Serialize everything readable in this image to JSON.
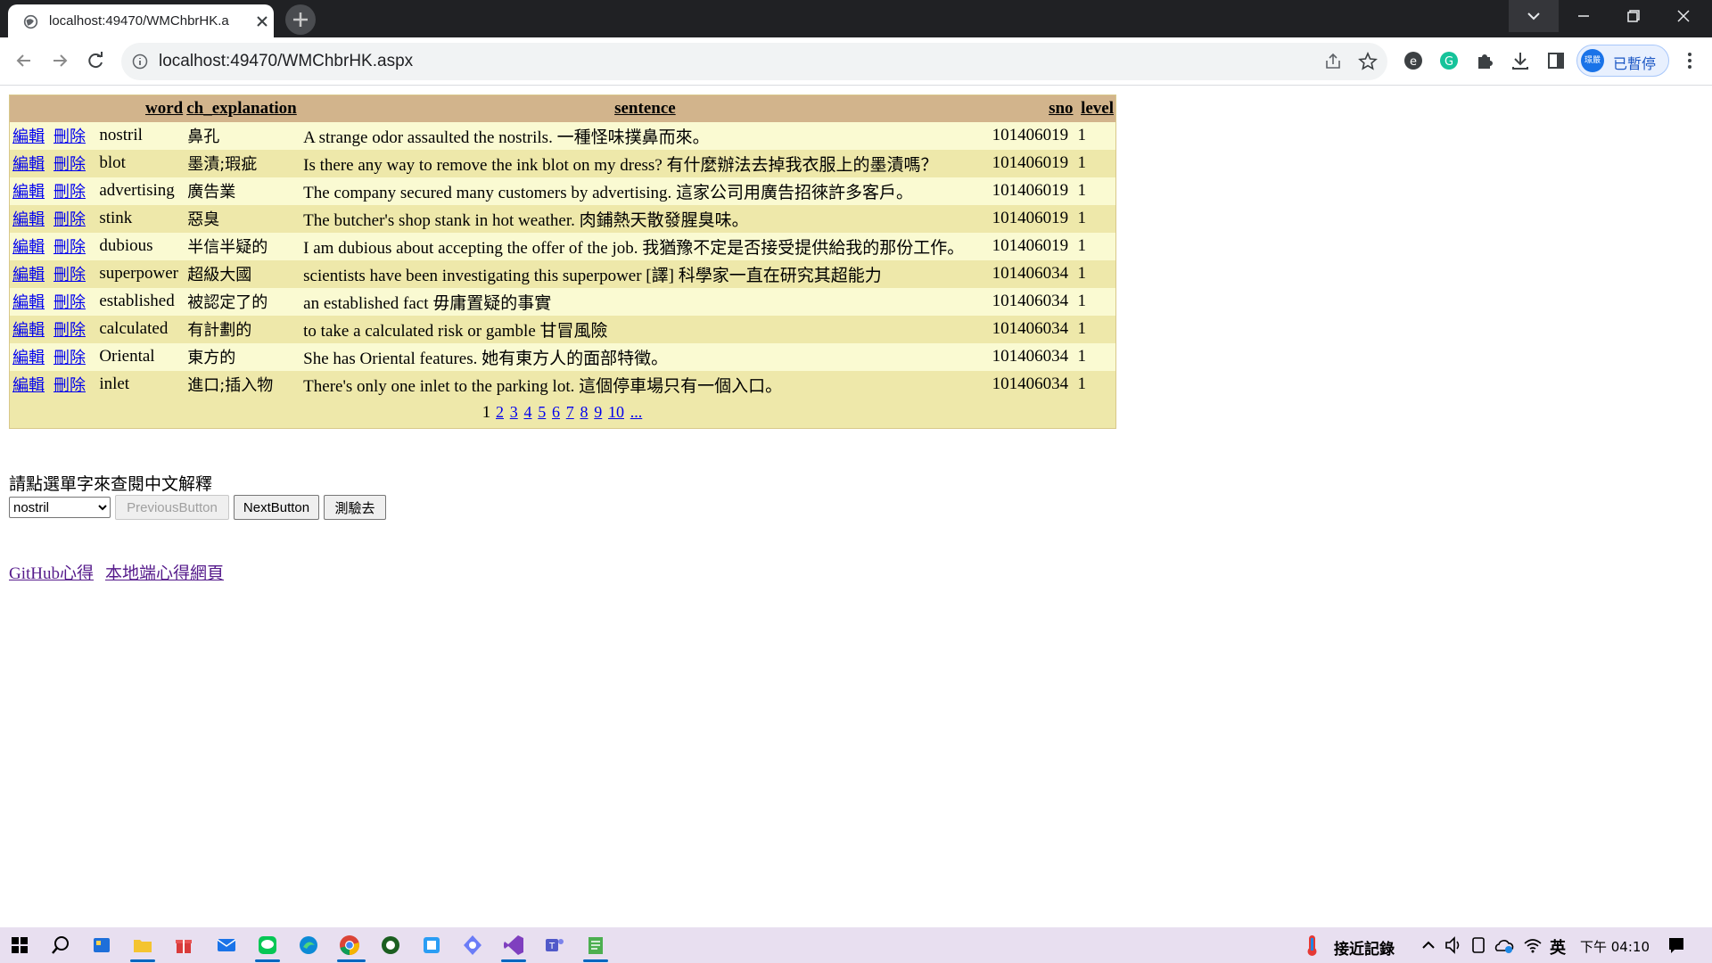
{
  "browser": {
    "tab_title": "localhost:49470/WMChbrHK.a",
    "url": "localhost:49470/WMChbrHK.aspx",
    "profile_label": "已暫停",
    "profile_avatar_text": "璟嚴"
  },
  "grid": {
    "headers": {
      "word": "word",
      "ch_explanation": "ch_explanation",
      "sentence": "sentence",
      "sno": "sno",
      "level": "level"
    },
    "edit_label": "編輯",
    "delete_label": "刪除",
    "rows": [
      {
        "word": "nostril",
        "ch": "鼻孔",
        "sentence": "A strange odor assaulted the nostrils. 一種怪味撲鼻而來。",
        "sno": "101406019",
        "level": "1"
      },
      {
        "word": "blot",
        "ch": "墨漬;瑕疵",
        "sentence": "Is there any way to remove the ink blot on my dress? 有什麼辦法去掉我衣服上的墨漬嗎？",
        "sno": "101406019",
        "level": "1"
      },
      {
        "word": "advertising",
        "ch": "廣告業",
        "sentence": "The company secured many customers by advertising. 這家公司用廣告招徠許多客戶。",
        "sno": "101406019",
        "level": "1"
      },
      {
        "word": "stink",
        "ch": "惡臭",
        "sentence": "The butcher's shop stank in hot weather. 肉鋪熱天散發腥臭味。",
        "sno": "101406019",
        "level": "1"
      },
      {
        "word": "dubious",
        "ch": "半信半疑的",
        "sentence": "I am dubious about accepting the offer of the job. 我猶豫不定是否接受提供給我的那份工作。",
        "sno": "101406019",
        "level": "1"
      },
      {
        "word": "superpower",
        "ch": "超級大國",
        "sentence": "scientists have been investigating this superpower [譯] 科學家一直在研究其超能力",
        "sno": "101406034",
        "level": "1"
      },
      {
        "word": "established",
        "ch": "被認定了的",
        "sentence": "an established fact 毋庸置疑的事實",
        "sno": "101406034",
        "level": "1"
      },
      {
        "word": "calculated",
        "ch": "有計劃的",
        "sentence": "to take a calculated risk or gamble 甘冒風險",
        "sno": "101406034",
        "level": "1"
      },
      {
        "word": "Oriental",
        "ch": "東方的",
        "sentence": "She has Oriental features. 她有東方人的面部特徵。",
        "sno": "101406034",
        "level": "1"
      },
      {
        "word": "inlet",
        "ch": "進口;插入物",
        "sentence": "There's only one inlet to the parking lot. 這個停車場只有一個入口。",
        "sno": "101406034",
        "level": "1"
      }
    ],
    "pager": {
      "current": "1",
      "pages": [
        "2",
        "3",
        "4",
        "5",
        "6",
        "7",
        "8",
        "9",
        "10"
      ],
      "more": "..."
    }
  },
  "controls": {
    "prompt": "請點選單字來查閱中文解釋",
    "selected_word": "nostril",
    "previous_button": "PreviousButton",
    "next_button": "NextButton",
    "quiz_button": "測驗去"
  },
  "links": {
    "github": "GitHub心得",
    "local": "本地端心得網頁"
  },
  "taskbar": {
    "weather_text": "接近記錄",
    "ime": "英",
    "clock": "下午 04:10"
  }
}
